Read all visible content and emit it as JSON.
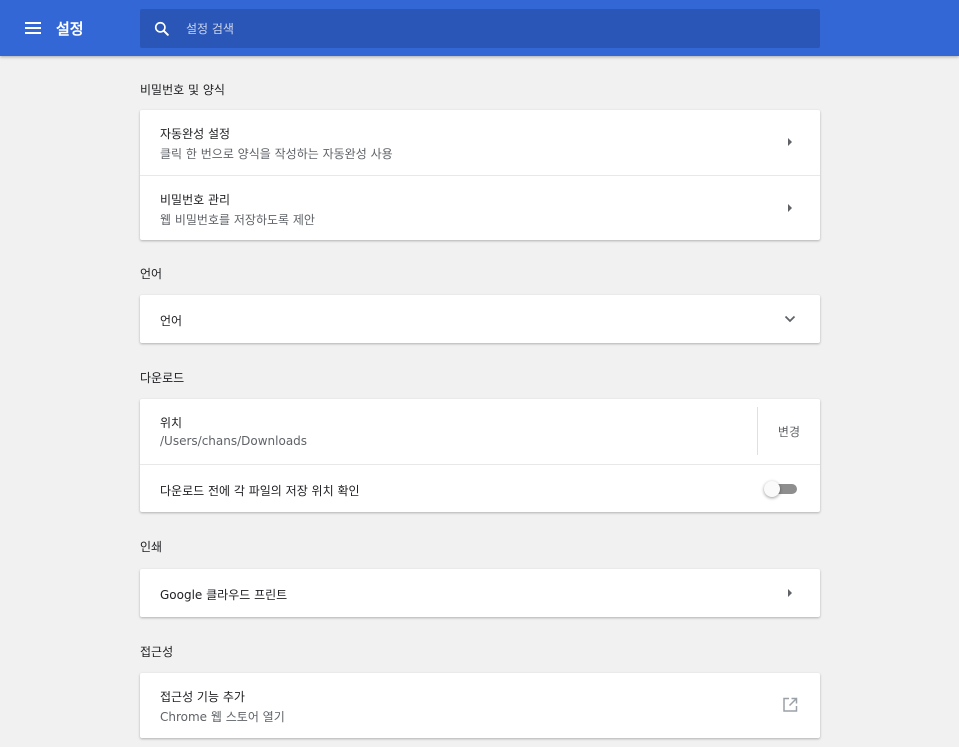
{
  "header": {
    "title": "설정",
    "search_placeholder": "설정 검색",
    "menu_icon": "hamburger-menu-icon",
    "search_icon": "search-icon"
  },
  "colors": {
    "toolbar": "#3367d6",
    "search_box": "#2a56b8",
    "background": "#f1f1f1"
  },
  "sections": {
    "passwords": {
      "title": "비밀번호 및 양식",
      "autofill": {
        "label": "자동완성 설정",
        "sub": "클릭 한 번으로 양식을 작성하는 자동완성 사용"
      },
      "manage": {
        "label": "비밀번호 관리",
        "sub": "웹 비밀번호를 저장하도록 제안"
      }
    },
    "languages": {
      "title": "언어",
      "language": {
        "label": "언어"
      }
    },
    "downloads": {
      "title": "다운로드",
      "location": {
        "label": "위치",
        "value": "/Users/chans/Downloads",
        "button": "변경"
      },
      "ask": {
        "label": "다운로드 전에 각 파일의 저장 위치 확인",
        "enabled": false
      }
    },
    "printing": {
      "title": "인쇄",
      "cloud_print": {
        "label": "Google 클라우드 프린트"
      }
    },
    "accessibility": {
      "title": "접근성",
      "add_features": {
        "label": "접근성 기능 추가",
        "sub": "Chrome 웹 스토어 열기"
      }
    }
  }
}
